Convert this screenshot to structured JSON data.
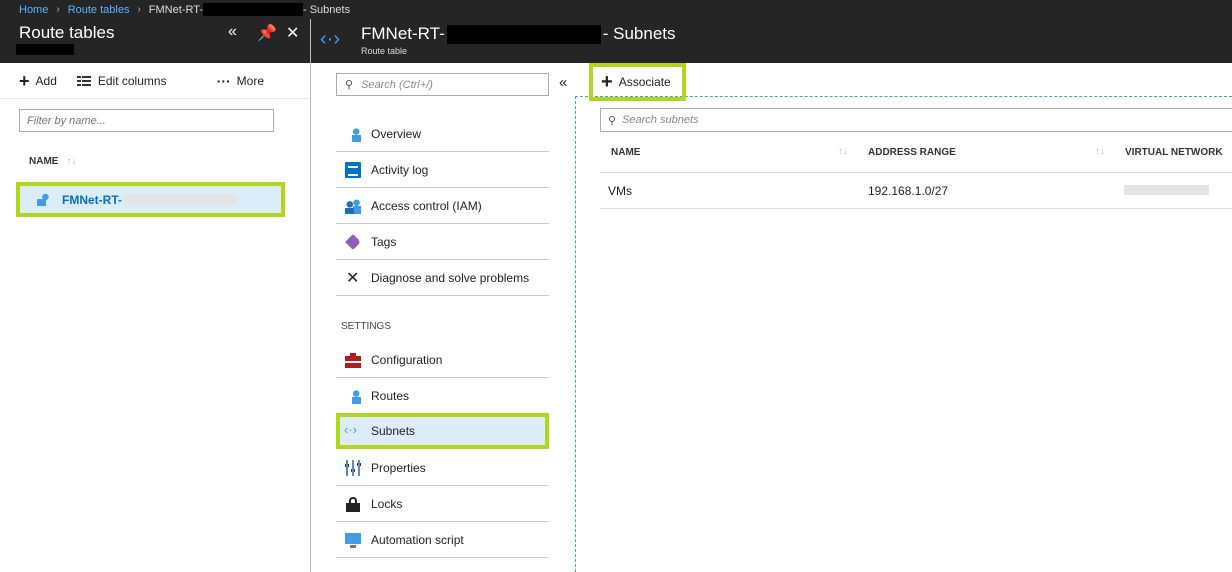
{
  "breadcrumb": {
    "home": "Home",
    "route_tables": "Route tables",
    "current_prefix": "FMNet-RT-",
    "current_suffix": "- Subnets"
  },
  "left_blade": {
    "title": "Route tables",
    "toolbar": {
      "add": "Add",
      "edit_columns": "Edit columns",
      "more": "More"
    },
    "filter_placeholder": "Filter by name...",
    "column_name": "NAME",
    "rows": [
      {
        "name": "FMNet-RT-"
      }
    ]
  },
  "right_blade": {
    "title_prefix": "FMNet-RT-",
    "title_suffix": "- Subnets",
    "subtitle": "Route table"
  },
  "menu": {
    "search_placeholder": "Search (Ctrl+/)",
    "items": [
      {
        "label": "Overview",
        "icon": "overview-icon"
      },
      {
        "label": "Activity log",
        "icon": "activity-log-icon"
      },
      {
        "label": "Access control (IAM)",
        "icon": "iam-icon"
      },
      {
        "label": "Tags",
        "icon": "tag-icon"
      },
      {
        "label": "Diagnose and solve problems",
        "icon": "tools-icon"
      }
    ],
    "settings_header": "SETTINGS",
    "settings_items": [
      {
        "label": "Configuration",
        "icon": "configuration-icon"
      },
      {
        "label": "Routes",
        "icon": "routes-icon"
      },
      {
        "label": "Subnets",
        "icon": "subnet-icon",
        "selected": true
      },
      {
        "label": "Properties",
        "icon": "properties-icon"
      },
      {
        "label": "Locks",
        "icon": "lock-icon"
      },
      {
        "label": "Automation script",
        "icon": "automation-icon"
      }
    ]
  },
  "content": {
    "associate_label": "Associate",
    "search_placeholder": "Search subnets",
    "columns": [
      "NAME",
      "ADDRESS RANGE",
      "VIRTUAL NETWORK"
    ],
    "rows": [
      {
        "name": "VMs",
        "address_range": "192.168.1.0/27"
      }
    ]
  },
  "colors": {
    "highlight": "#b2d61c",
    "accent": "#0072c6",
    "header_bg": "#252526",
    "selected_bg": "#dcecfb"
  }
}
